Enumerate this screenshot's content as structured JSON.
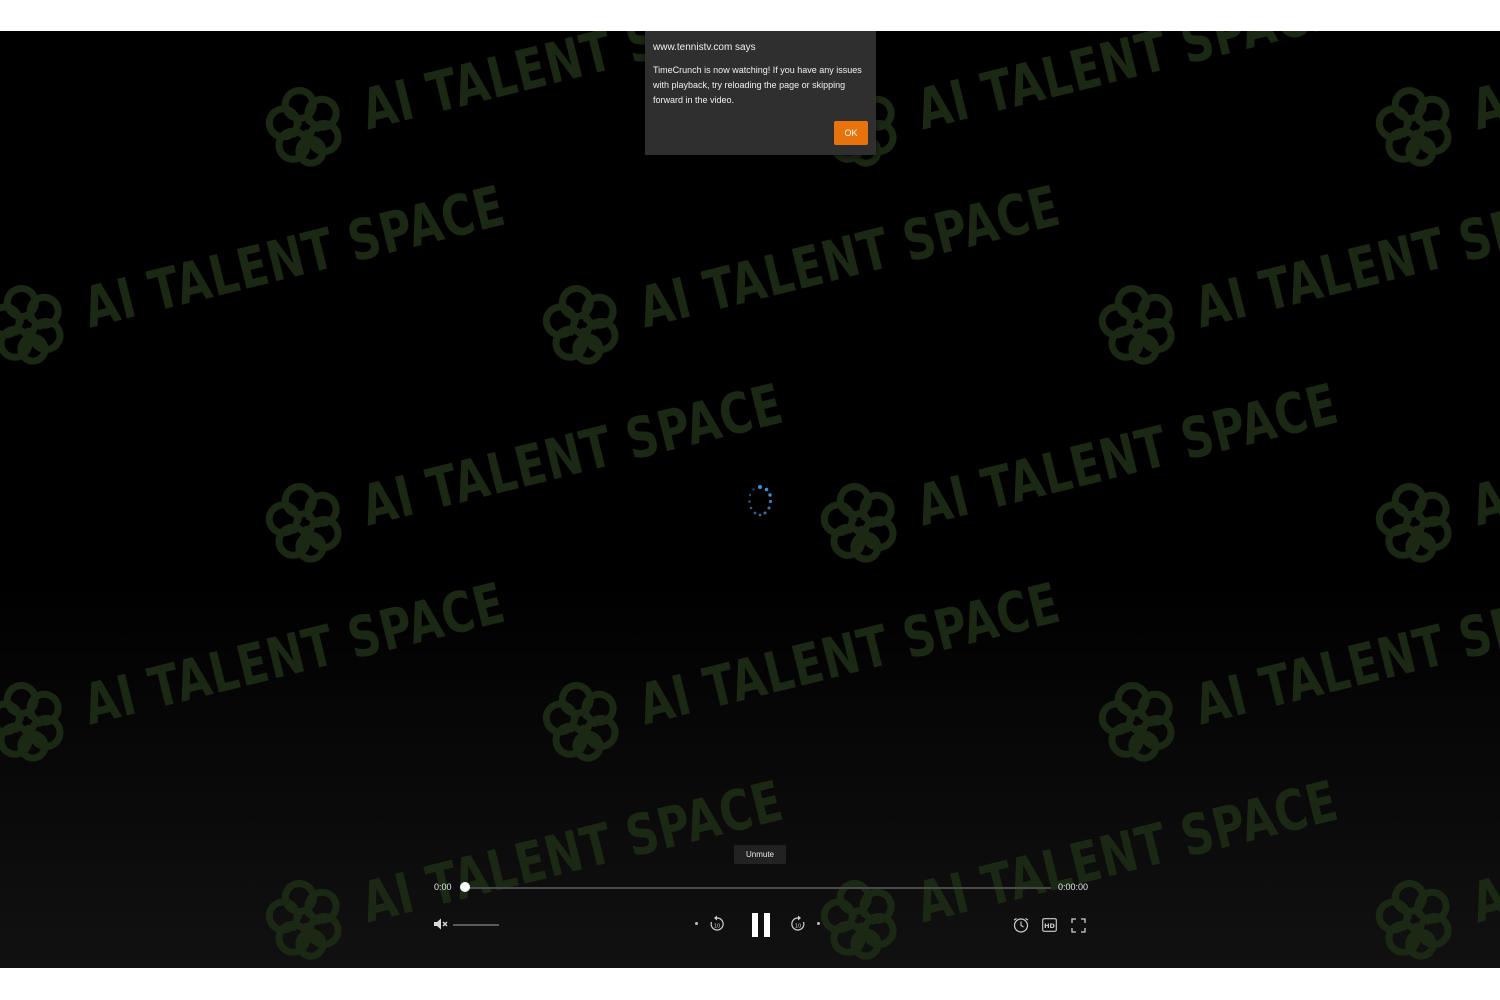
{
  "dialog": {
    "title": "www.tennistv.com says",
    "message": "TimeCrunch is now watching! If you have any issues with playback, try reloading the page or skipping forward in the video.",
    "ok_label": "OK"
  },
  "player": {
    "loading_icon": "loading-spinner-icon",
    "tooltip": "Unmute",
    "current_time": "0:00",
    "total_time": "0:00:00",
    "progress": 0,
    "volume_icon": "muted-speaker-icon",
    "rewind_icon": "rewind-10-icon",
    "pause_icon": "pause-icon",
    "forward_icon": "forward-10-icon",
    "clock_icon": "clock-icon",
    "hd_icon": "hd-icon",
    "fullscreen_icon": "fullscreen-icon"
  },
  "watermark": {
    "text": "AI TALENT SPACE",
    "color": "#1b2914"
  },
  "colors": {
    "accent": "#e8730c",
    "spinner": "#3a8fd6"
  }
}
